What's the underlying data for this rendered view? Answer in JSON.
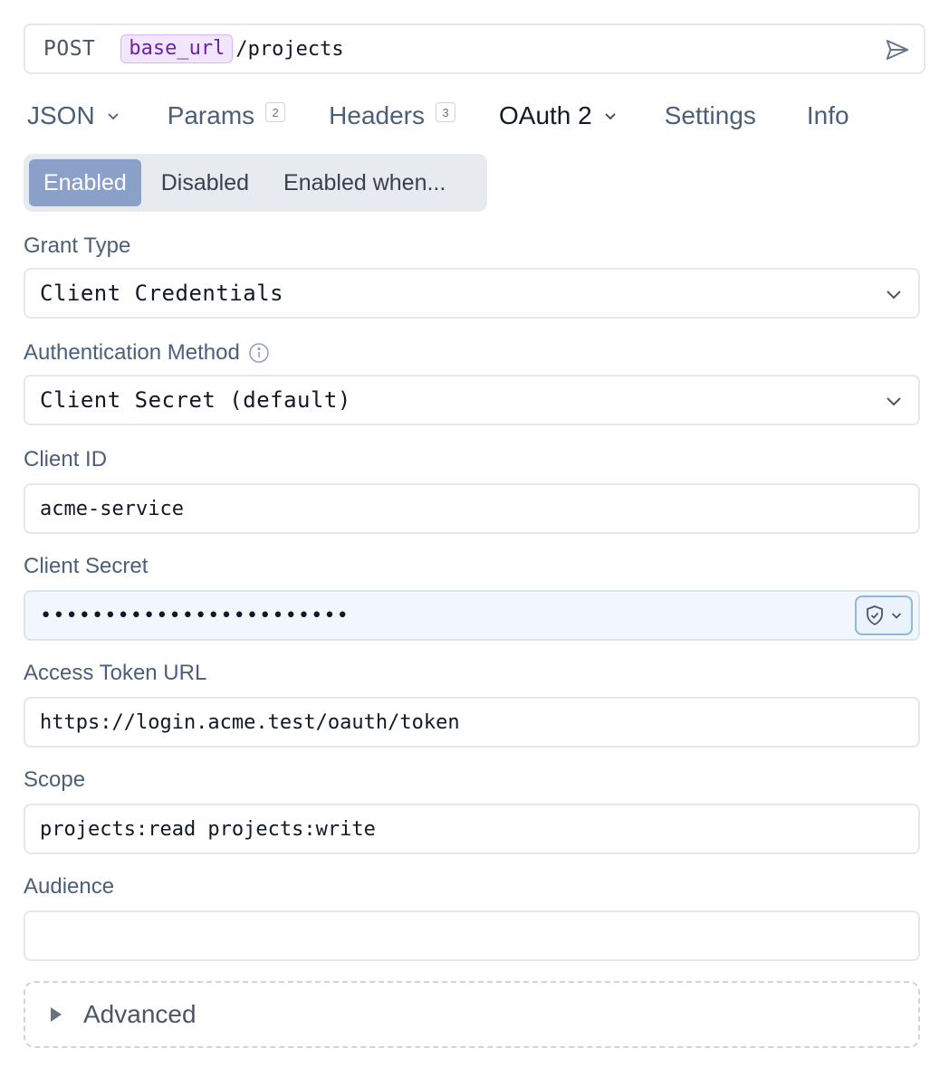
{
  "request": {
    "method": "POST",
    "variable": "base_url",
    "path": "/projects"
  },
  "tabs": [
    {
      "label": "JSON",
      "dropdown": true
    },
    {
      "label": "Params",
      "badge": "2"
    },
    {
      "label": "Headers",
      "badge": "3"
    },
    {
      "label": "OAuth 2",
      "dropdown": true,
      "active": true
    },
    {
      "label": "Settings"
    },
    {
      "label": "Info"
    }
  ],
  "auth_state": {
    "options": [
      "Enabled",
      "Disabled",
      "Enabled when..."
    ],
    "selected": "Enabled"
  },
  "form": {
    "grant_type": {
      "label": "Grant Type",
      "value": "Client Credentials"
    },
    "auth_method": {
      "label": "Authentication Method",
      "value": "Client Secret (default)"
    },
    "client_id": {
      "label": "Client ID",
      "value": "acme-service"
    },
    "client_secret": {
      "label": "Client Secret",
      "value": "••••••••••••••••••••••••"
    },
    "token_url": {
      "label": "Access Token URL",
      "value": "https://login.acme.test/oauth/token"
    },
    "scope": {
      "label": "Scope",
      "value": "projects:read projects:write"
    },
    "audience": {
      "label": "Audience",
      "value": ""
    }
  },
  "advanced": {
    "label": "Advanced"
  },
  "colors": {
    "accent": "#8aa0c8",
    "variable": "#6b21a8",
    "label": "#4b5e7a"
  }
}
